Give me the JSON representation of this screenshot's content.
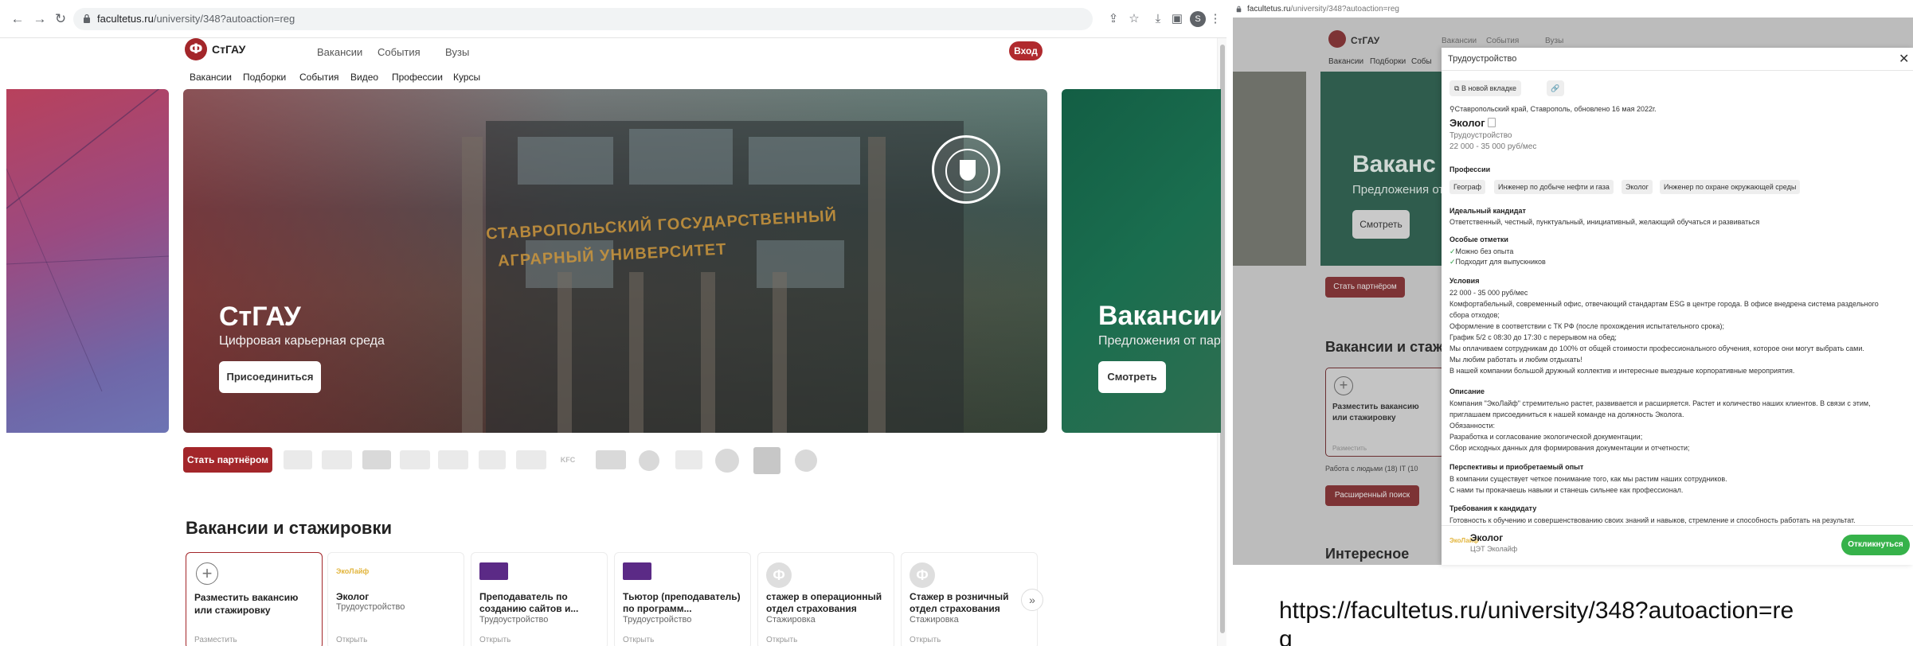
{
  "left_browser": {
    "url_domain": "facultetus.ru",
    "url_path": "/university/348?autoaction=reg",
    "profile_initial": "S"
  },
  "site": {
    "name": "СтГАУ",
    "top_nav": [
      "Вакансии",
      "События",
      "Вузы"
    ],
    "login_label": "Вход",
    "sub_nav": [
      "Вакансии",
      "Подборки",
      "События",
      "Видео",
      "Профессии",
      "Курсы"
    ]
  },
  "hero": {
    "title": "СтГАУ",
    "subtitle": "Цифровая карьерная среда",
    "button": "Присоединиться",
    "sign_line1": "СТАВРОПОЛЬСКИЙ ГОСУДАРСТВЕННЫЙ",
    "sign_line2": "АГРАРНЫЙ УНИВЕРСИТЕТ"
  },
  "next_slide": {
    "title": "Вакансии",
    "subtitle": "Предложения от партнеров",
    "button": "Смотреть"
  },
  "partners": {
    "button": "Стать партнёром",
    "logo_labels": [
      "KFC"
    ]
  },
  "vacancies_section": {
    "title": "Вакансии и стажировки",
    "add_card": {
      "label": "Разместить вакансию или стажировку",
      "action": "Разместить"
    },
    "cards": [
      {
        "logo_text": "ЭкоЛайф",
        "title": "Эколог",
        "type": "Трудоустройство",
        "action": "Открыть"
      },
      {
        "logo_text": "",
        "title": "Преподаватель по созданию сайтов и...",
        "type": "Трудоустройство",
        "action": "Открыть"
      },
      {
        "logo_text": "",
        "title": "Тьютор (преподаватель) по программ...",
        "type": "Трудоустройство",
        "action": "Открыть"
      },
      {
        "logo_text": "Ф",
        "title": "стажер в операционный отдел страхования",
        "type": "Стажировка",
        "action": "Открыть"
      },
      {
        "logo_text": "Ф",
        "title": "Стажер в розничный отдел страхования",
        "type": "Стажировка",
        "action": "Открыть"
      }
    ]
  },
  "right_browser": {
    "url_domain": "facultetus.ru",
    "url_path": "/university/348?autoaction=reg"
  },
  "bg_page": {
    "name": "СтГАУ",
    "top_nav": [
      "Вакансии",
      "События",
      "Вузы"
    ],
    "sub_nav": [
      "Вакансии",
      "Подборки",
      "Собы"
    ],
    "slide_title": "Ваканс",
    "slide_sub": "Предложения от",
    "slide_button": "Смотреть",
    "partner_button": "Стать партнёром",
    "section": "Вакансии и стаж",
    "add_card_label": "Разместить вакансию или стажировку",
    "add_card_action": "Разместить",
    "tag_line": "Работа с людьми (18)    IT (10",
    "extended_search": "Расширенный поиск",
    "section2": "Интересное"
  },
  "panel": {
    "title": "Трудоустройство",
    "open_new_tab": "В новой вкладке",
    "location": "Ставропольский край, Ставрополь, обновлено 16 мая 2022г.",
    "job_title": "Эколог",
    "job_type": "Трудоустройство",
    "salary": "22 000 - 35 000 руб/мес",
    "professions_heading": "Профессии",
    "professions": [
      "Географ",
      "Инженер по добыче нефти и газа",
      "Эколог",
      "Инженер по охране окружающей среды"
    ],
    "ideal_heading": "Идеальный кандидат",
    "ideal_text": "Ответственный, честный, пунктуальный, инициативный, желающий обучаться и развиваться",
    "special_heading": "Особые отметки",
    "special": [
      "Можно без опыта",
      "Подходит для выпускников"
    ],
    "conditions_heading": "Условия",
    "conditions": [
      "22 000 - 35 000 руб/мес",
      "Комфортабельный, современный офис, отвечающий стандартам ESG в центре города. В офисе внедрена система раздельного",
      "сбора отходов;",
      "Оформление в соответствии с ТК РФ (после прохождения испытательного срока);",
      "График 5/2 с 08:30 до 17:30 с перерывом на обед;",
      "Мы оплачиваем сотрудникам до 100% от общей стоимости профессионального обучения, которое они могут выбрать сами.",
      "Мы любим работать и любим отдыхать!",
      "В нашей компании большой дружный коллектив и интересные выездные корпоративные мероприятия."
    ],
    "description_heading": "Описание",
    "description": [
      "Компания \"ЭкоЛайф\" стремительно растет, развивается и расширяется. Растет и количество наших клиентов. В связи с этим,",
      "приглашаем присоединиться к нашей команде на должность Эколога.",
      "Обязанности:",
      "Разработка и согласование экологической документации;",
      "Сбор исходных данных для формирования документации и отчетности;"
    ],
    "prospects_heading": "Перспективы и приобретаемый опыт",
    "prospects": [
      "В компании существует четкое понимание того, как мы растим наших сотрудников.",
      "С нами ты прокачаешь навыки и станешь сильнее как профессионал."
    ],
    "requirements_heading": "Требования к кандидату",
    "requirements": "Готовность к обучению и совершенствованию своих знаний и навыков, стремление и способность работать на результат.",
    "footer_logo": "ЭкоЛайф",
    "footer_title": "Эколог",
    "footer_company": "ЦЭТ Эколайф",
    "apply": "Откликнуться"
  },
  "caption_url": "https://facultetus.ru/university/348?autoaction=re",
  "caption_url_wrap": "g"
}
